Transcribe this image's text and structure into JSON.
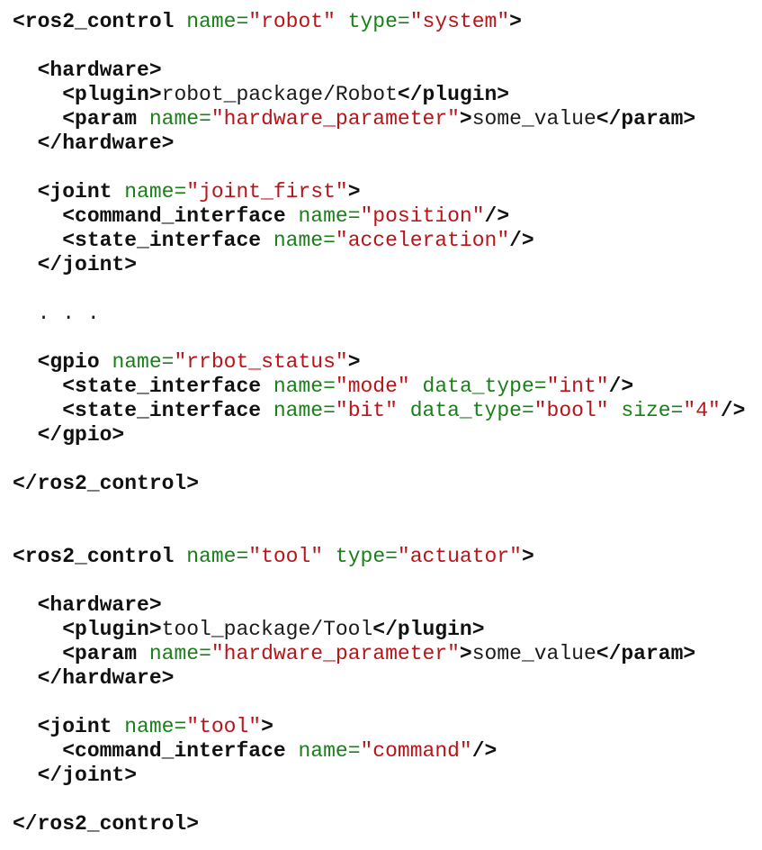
{
  "code_lines": [
    [
      {
        "t": "tag",
        "s": "<ros2_control"
      },
      {
        "t": "txt",
        "s": " "
      },
      {
        "t": "attr",
        "s": "name="
      },
      {
        "t": "val",
        "s": "\"robot\""
      },
      {
        "t": "txt",
        "s": " "
      },
      {
        "t": "attr",
        "s": "type="
      },
      {
        "t": "val",
        "s": "\"system\""
      },
      {
        "t": "tag",
        "s": ">"
      }
    ],
    [],
    [
      {
        "t": "txt",
        "s": "  "
      },
      {
        "t": "tag",
        "s": "<hardware>"
      }
    ],
    [
      {
        "t": "txt",
        "s": "    "
      },
      {
        "t": "tag",
        "s": "<plugin>"
      },
      {
        "t": "txt",
        "s": "robot_package/Robot"
      },
      {
        "t": "tag",
        "s": "</plugin>"
      }
    ],
    [
      {
        "t": "txt",
        "s": "    "
      },
      {
        "t": "tag",
        "s": "<param"
      },
      {
        "t": "txt",
        "s": " "
      },
      {
        "t": "attr",
        "s": "name="
      },
      {
        "t": "val",
        "s": "\"hardware_parameter\""
      },
      {
        "t": "tag",
        "s": ">"
      },
      {
        "t": "txt",
        "s": "some_value"
      },
      {
        "t": "tag",
        "s": "</param>"
      }
    ],
    [
      {
        "t": "txt",
        "s": "  "
      },
      {
        "t": "tag",
        "s": "</hardware>"
      }
    ],
    [],
    [
      {
        "t": "txt",
        "s": "  "
      },
      {
        "t": "tag",
        "s": "<joint"
      },
      {
        "t": "txt",
        "s": " "
      },
      {
        "t": "attr",
        "s": "name="
      },
      {
        "t": "val",
        "s": "\"joint_first\""
      },
      {
        "t": "tag",
        "s": ">"
      }
    ],
    [
      {
        "t": "txt",
        "s": "    "
      },
      {
        "t": "tag",
        "s": "<command_interface"
      },
      {
        "t": "txt",
        "s": " "
      },
      {
        "t": "attr",
        "s": "name="
      },
      {
        "t": "val",
        "s": "\"position\""
      },
      {
        "t": "tag",
        "s": "/>"
      }
    ],
    [
      {
        "t": "txt",
        "s": "    "
      },
      {
        "t": "tag",
        "s": "<state_interface"
      },
      {
        "t": "txt",
        "s": " "
      },
      {
        "t": "attr",
        "s": "name="
      },
      {
        "t": "val",
        "s": "\"acceleration\""
      },
      {
        "t": "tag",
        "s": "/>"
      }
    ],
    [
      {
        "t": "txt",
        "s": "  "
      },
      {
        "t": "tag",
        "s": "</joint>"
      }
    ],
    [],
    [
      {
        "t": "txt",
        "s": "  . . ."
      }
    ],
    [],
    [
      {
        "t": "txt",
        "s": "  "
      },
      {
        "t": "tag",
        "s": "<gpio"
      },
      {
        "t": "txt",
        "s": " "
      },
      {
        "t": "attr",
        "s": "name="
      },
      {
        "t": "val",
        "s": "\"rrbot_status\""
      },
      {
        "t": "tag",
        "s": ">"
      }
    ],
    [
      {
        "t": "txt",
        "s": "    "
      },
      {
        "t": "tag",
        "s": "<state_interface"
      },
      {
        "t": "txt",
        "s": " "
      },
      {
        "t": "attr",
        "s": "name="
      },
      {
        "t": "val",
        "s": "\"mode\""
      },
      {
        "t": "txt",
        "s": " "
      },
      {
        "t": "attr",
        "s": "data_type="
      },
      {
        "t": "val",
        "s": "\"int\""
      },
      {
        "t": "tag",
        "s": "/>"
      }
    ],
    [
      {
        "t": "txt",
        "s": "    "
      },
      {
        "t": "tag",
        "s": "<state_interface"
      },
      {
        "t": "txt",
        "s": " "
      },
      {
        "t": "attr",
        "s": "name="
      },
      {
        "t": "val",
        "s": "\"bit\""
      },
      {
        "t": "txt",
        "s": " "
      },
      {
        "t": "attr",
        "s": "data_type="
      },
      {
        "t": "val",
        "s": "\"bool\""
      },
      {
        "t": "txt",
        "s": " "
      },
      {
        "t": "attr",
        "s": "size="
      },
      {
        "t": "val",
        "s": "\"4\""
      },
      {
        "t": "tag",
        "s": "/>"
      }
    ],
    [
      {
        "t": "txt",
        "s": "  "
      },
      {
        "t": "tag",
        "s": "</gpio>"
      }
    ],
    [],
    [
      {
        "t": "tag",
        "s": "</ros2_control>"
      }
    ],
    [],
    [],
    [
      {
        "t": "tag",
        "s": "<ros2_control"
      },
      {
        "t": "txt",
        "s": " "
      },
      {
        "t": "attr",
        "s": "name="
      },
      {
        "t": "val",
        "s": "\"tool\""
      },
      {
        "t": "txt",
        "s": " "
      },
      {
        "t": "attr",
        "s": "type="
      },
      {
        "t": "val",
        "s": "\"actuator\""
      },
      {
        "t": "tag",
        "s": ">"
      }
    ],
    [],
    [
      {
        "t": "txt",
        "s": "  "
      },
      {
        "t": "tag",
        "s": "<hardware>"
      }
    ],
    [
      {
        "t": "txt",
        "s": "    "
      },
      {
        "t": "tag",
        "s": "<plugin>"
      },
      {
        "t": "txt",
        "s": "tool_package/Tool"
      },
      {
        "t": "tag",
        "s": "</plugin>"
      }
    ],
    [
      {
        "t": "txt",
        "s": "    "
      },
      {
        "t": "tag",
        "s": "<param"
      },
      {
        "t": "txt",
        "s": " "
      },
      {
        "t": "attr",
        "s": "name="
      },
      {
        "t": "val",
        "s": "\"hardware_parameter\""
      },
      {
        "t": "tag",
        "s": ">"
      },
      {
        "t": "txt",
        "s": "some_value"
      },
      {
        "t": "tag",
        "s": "</param>"
      }
    ],
    [
      {
        "t": "txt",
        "s": "  "
      },
      {
        "t": "tag",
        "s": "</hardware>"
      }
    ],
    [],
    [
      {
        "t": "txt",
        "s": "  "
      },
      {
        "t": "tag",
        "s": "<joint"
      },
      {
        "t": "txt",
        "s": " "
      },
      {
        "t": "attr",
        "s": "name="
      },
      {
        "t": "val",
        "s": "\"tool\""
      },
      {
        "t": "tag",
        "s": ">"
      }
    ],
    [
      {
        "t": "txt",
        "s": "    "
      },
      {
        "t": "tag",
        "s": "<command_interface"
      },
      {
        "t": "txt",
        "s": " "
      },
      {
        "t": "attr",
        "s": "name="
      },
      {
        "t": "val",
        "s": "\"command\""
      },
      {
        "t": "tag",
        "s": "/>"
      }
    ],
    [
      {
        "t": "txt",
        "s": "  "
      },
      {
        "t": "tag",
        "s": "</joint>"
      }
    ],
    [],
    [
      {
        "t": "tag",
        "s": "</ros2_control>"
      }
    ]
  ]
}
